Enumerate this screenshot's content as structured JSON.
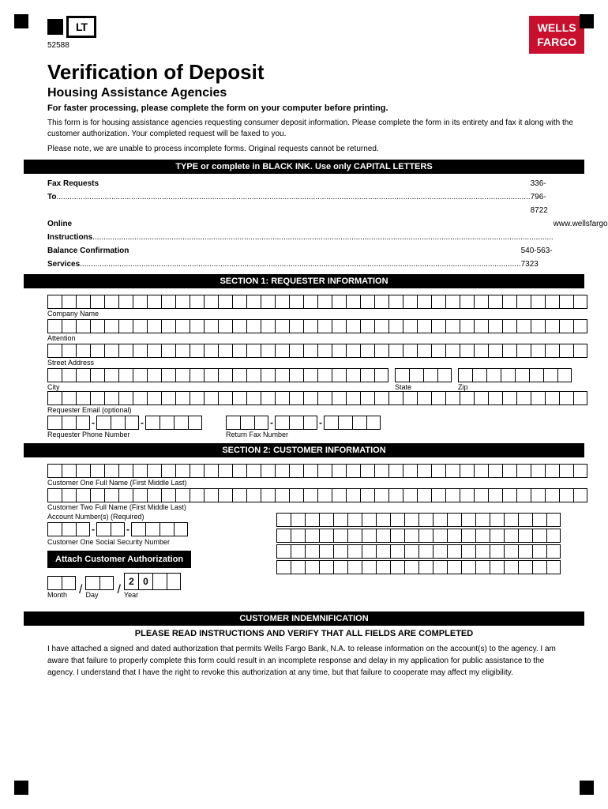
{
  "corners": {
    "tl": true,
    "tr": true,
    "bl": true,
    "br": true
  },
  "logo": {
    "letters": "LT",
    "number": "52588"
  },
  "wells_fargo": {
    "line1": "WELLS",
    "line2": "FARGO"
  },
  "title": "Verification of Deposit",
  "subtitle": "Housing Assistance Agencies",
  "intro_bold": "For faster processing, please complete the form on your computer before printing.",
  "intro_normal": "This form is for housing assistance agencies requesting consumer deposit information.  Please complete the form in its entirety and fax it along with the customer authorization.  Your completed request will be faxed to you.",
  "intro_note": "Please note, we are unable to process incomplete forms.  Original requests cannot be returned.",
  "type_bar": "TYPE or complete in BLACK INK.  Use only CAPITAL LETTERS",
  "contact": {
    "fax_label": "Fax Requests To",
    "fax_value": "336-796-8722",
    "online_label": "Online Instructions",
    "online_value": "www.wellsfargo.com/biz/vod",
    "balance_label": "Balance Confirmation Services",
    "balance_value": "540-563-7323"
  },
  "section1": {
    "title": "SECTION 1:  REQUESTER INFORMATION",
    "fields": {
      "company_name_label": "Company Name",
      "attention_label": "Attention",
      "street_address_label": "Street Address",
      "city_label": "City",
      "state_label": "State",
      "zip_label": "Zip",
      "email_label": "Requester  Email (optional)",
      "phone_label": "Requester Phone Number",
      "fax_label": "Return Fax Number"
    },
    "company_name_cells": 38,
    "attention_cells": 38,
    "street_cells": 38,
    "city_cells": 24,
    "state_cells": 4,
    "zip_cells": 8,
    "email_cells": 38,
    "phone_area_cells": 3,
    "phone_mid_cells": 3,
    "phone_end_cells": 4,
    "fax_area_cells": 3,
    "fax_mid_cells": 3,
    "fax_end_cells": 4
  },
  "section2": {
    "title": "SECTION 2:  CUSTOMER INFORMATION",
    "fields": {
      "customer1_label": "Customer One Full Name (First Middle Last)",
      "customer2_label": "Customer Two Full Name (First Middle Last)",
      "ssn_label": "Customer One Social Security Number",
      "account_label": "Account Number(s) (Required)",
      "attach_btn": "Attach Customer Authorization",
      "month_label": "Month",
      "day_label": "Day",
      "year_label": "Year",
      "year_prefix": "20"
    },
    "customer1_cells": 38,
    "customer2_cells": 38,
    "ssn_area_cells": 3,
    "ssn_mid_cells": 2,
    "ssn_end_cells": 4,
    "account_row1_cells": 20,
    "account_row2_cells": 20,
    "account_row3_cells": 20,
    "account_row4_cells": 20,
    "month_cells": 2,
    "day_cells": 2,
    "year_extra_cells": 2
  },
  "indemnification": {
    "bar_title": "CUSTOMER INDEMNIFICATION",
    "subtitle": "PLEASE READ INSTRUCTIONS AND VERIFY THAT ALL FIELDS ARE COMPLETED",
    "text": "I have attached a signed and dated authorization that permits Wells Fargo Bank, N.A.  to release information on the account(s) to the agency.  I am aware that failure to properly complete this form could result in an incomplete response and delay in my application for public assistance to the agency.  I understand that I have the right to revoke this authorization at any time, but that failure to cooperate may affect my eligibility."
  }
}
